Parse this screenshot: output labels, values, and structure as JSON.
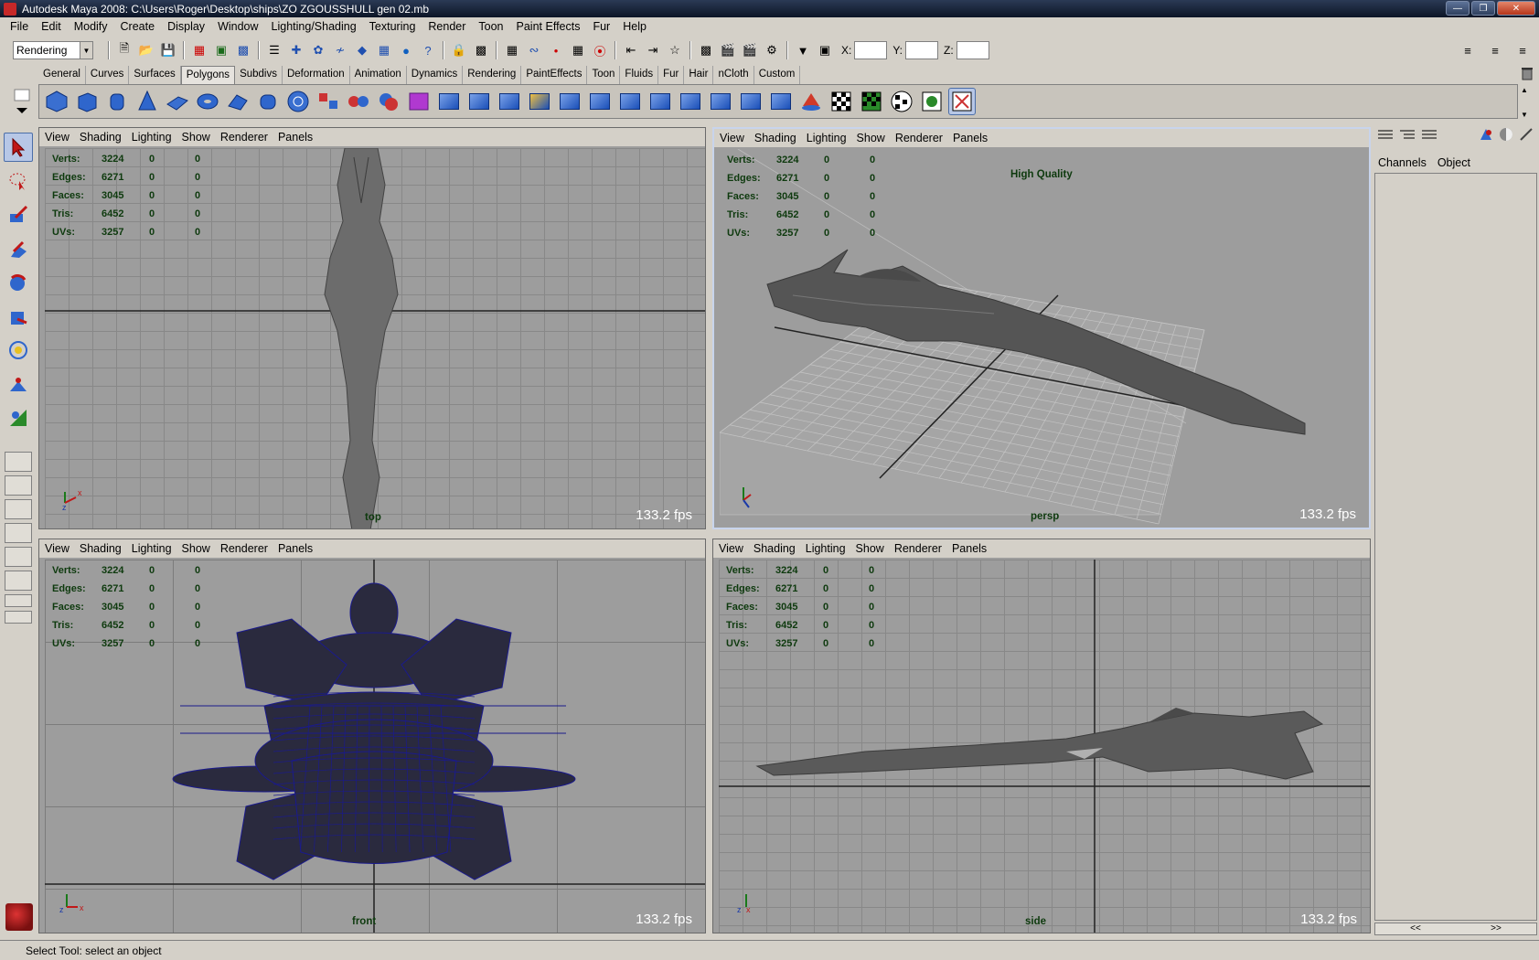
{
  "window": {
    "title": "Autodesk Maya 2008: C:\\Users\\Roger\\Desktop\\ships\\ZO ZGOUSSHULL gen 02.mb",
    "controls": [
      "minimize-icon",
      "restore-icon",
      "close-icon"
    ]
  },
  "menubar": {
    "items": [
      "File",
      "Edit",
      "Modify",
      "Create",
      "Display",
      "Window",
      "Lighting/Shading",
      "Texturing",
      "Render",
      "Toon",
      "Paint Effects",
      "Fur",
      "Help"
    ]
  },
  "statusline": {
    "mode": "Rendering",
    "coord_labels": {
      "x": "X:",
      "y": "Y:",
      "z": "Z:"
    },
    "coord_values": {
      "x": "",
      "y": "",
      "z": ""
    }
  },
  "shelf": {
    "tabs": [
      "General",
      "Curves",
      "Surfaces",
      "Polygons",
      "Subdivs",
      "Deformation",
      "Animation",
      "Dynamics",
      "Rendering",
      "PaintEffects",
      "Toon",
      "Fluids",
      "Fur",
      "Hair",
      "nCloth",
      "Custom"
    ],
    "active_tab": "Polygons"
  },
  "viewport_menu": [
    "View",
    "Shading",
    "Lighting",
    "Show",
    "Renderer",
    "Panels"
  ],
  "hud": {
    "labels": [
      "Verts:",
      "Edges:",
      "Faces:",
      "Tris:",
      "UVs:"
    ],
    "values": [
      [
        "3224",
        "0",
        "0"
      ],
      [
        "6271",
        "0",
        "0"
      ],
      [
        "3045",
        "0",
        "0"
      ],
      [
        "6452",
        "0",
        "0"
      ],
      [
        "3257",
        "0",
        "0"
      ]
    ]
  },
  "viewports": {
    "top": {
      "camera": "top",
      "fps": "133.2 fps"
    },
    "persp": {
      "camera": "persp",
      "fps": "133.2 fps",
      "quality": "High Quality"
    },
    "front": {
      "camera": "front",
      "fps": "133.2 fps"
    },
    "side": {
      "camera": "side",
      "fps": "133.2 fps"
    }
  },
  "channelbox": {
    "tabs": [
      "Channels",
      "Object"
    ],
    "scroll": [
      "<<",
      ">>"
    ]
  },
  "helpline": {
    "text": "Select Tool: select an object"
  },
  "colors": {
    "hud_text": "#0e3a0e",
    "viewport_bg": "#9d9d9d",
    "wireframe": "#1a1a8c",
    "ui_gray": "#d4d0c8"
  }
}
